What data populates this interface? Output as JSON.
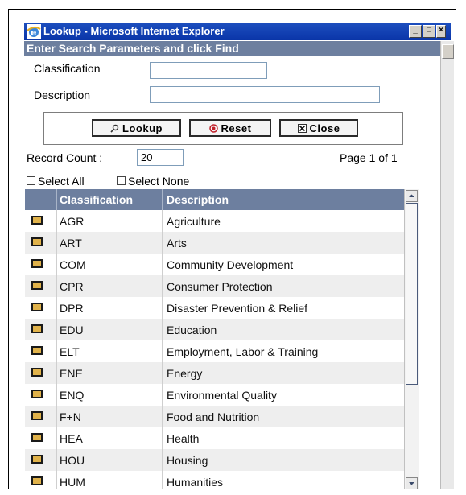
{
  "window": {
    "title": "Lookup - Microsoft Internet Explorer"
  },
  "header": {
    "text": "Enter Search Parameters and click Find"
  },
  "form": {
    "classification_label": "Classification",
    "classification_value": "",
    "description_label": "Description",
    "description_value": ""
  },
  "buttons": {
    "lookup": "Lookup",
    "reset": "Reset",
    "close": "Close"
  },
  "record_count": {
    "label": "Record Count :",
    "value": "20"
  },
  "page_info": "Page 1 of 1",
  "select": {
    "all": "Select All",
    "none": "Select None"
  },
  "grid": {
    "columns": [
      "Classification",
      "Description"
    ],
    "rows": [
      {
        "code": "AGR",
        "desc": "Agriculture"
      },
      {
        "code": "ART",
        "desc": "Arts"
      },
      {
        "code": "COM",
        "desc": "Community Development"
      },
      {
        "code": "CPR",
        "desc": "Consumer Protection"
      },
      {
        "code": "DPR",
        "desc": "Disaster Prevention & Relief"
      },
      {
        "code": "EDU",
        "desc": "Education"
      },
      {
        "code": "ELT",
        "desc": "Employment, Labor & Training"
      },
      {
        "code": "ENE",
        "desc": "Energy"
      },
      {
        "code": "ENQ",
        "desc": "Environmental Quality"
      },
      {
        "code": "F+N",
        "desc": "Food and Nutrition"
      },
      {
        "code": "HEA",
        "desc": "Health"
      },
      {
        "code": "HOU",
        "desc": "Housing"
      },
      {
        "code": "HUM",
        "desc": "Humanities"
      }
    ]
  },
  "colors": {
    "header_band": "#6d7f9f",
    "titlebar": "#0a35a8",
    "row_alt": "#eeeeee",
    "row_icon": "#e0b24a"
  }
}
